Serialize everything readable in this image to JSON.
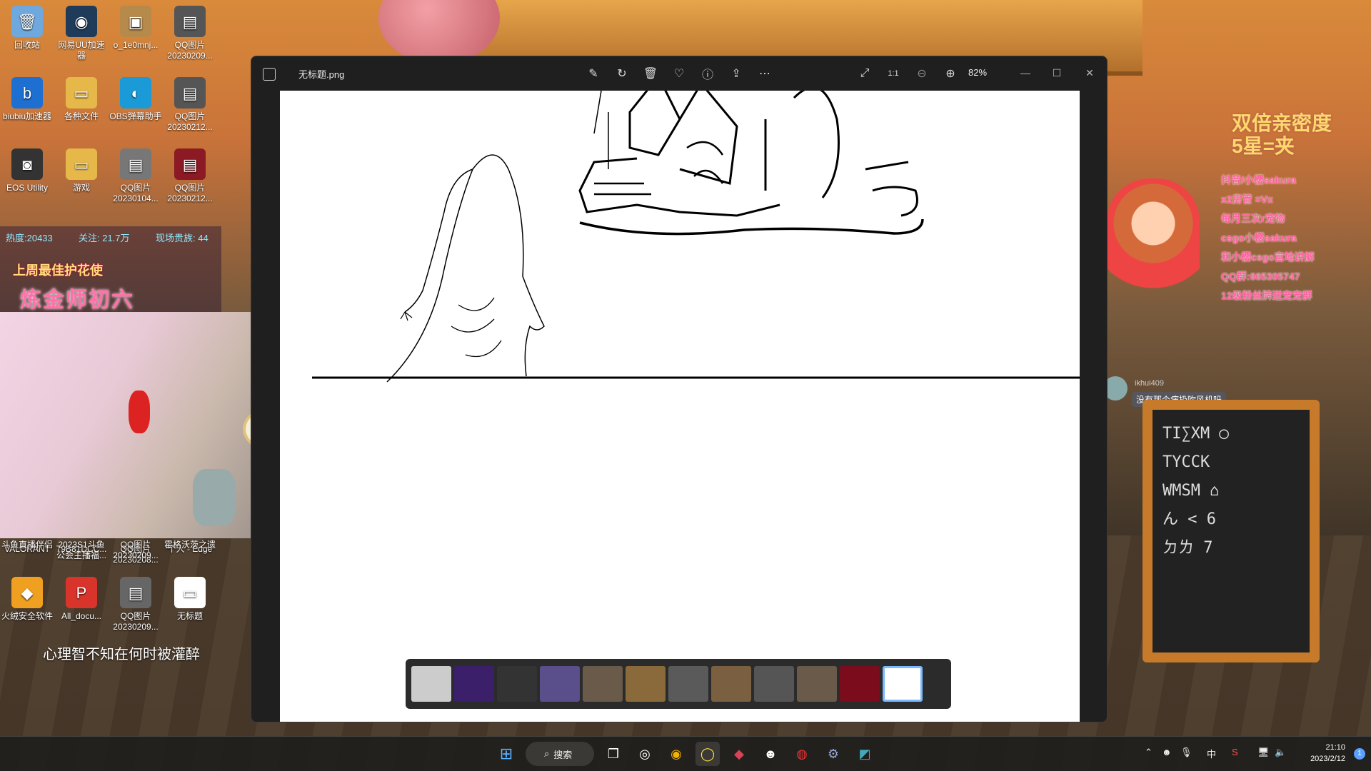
{
  "desktop": {
    "icons": [
      {
        "label": "回收站",
        "glyph": "🗑",
        "color": "#6fa8dc"
      },
      {
        "label": "网易UU加速器",
        "glyph": "◉",
        "color": "#1e3b5a"
      },
      {
        "label": "o_1e0mnj...",
        "glyph": "▣",
        "color": "#b58a4a"
      },
      {
        "label": "QQ图片 20230209...",
        "glyph": "▤",
        "color": "#555"
      },
      {
        "label": "biubiu加速器",
        "glyph": "b",
        "color": "#1d6fd1"
      },
      {
        "label": "各种文件",
        "glyph": "▭",
        "color": "#e6b84a"
      },
      {
        "label": "OBS弹幕助手",
        "glyph": "◐",
        "color": "#1a9ad6"
      },
      {
        "label": "QQ图片 20230212...",
        "glyph": "▤",
        "color": "#555"
      },
      {
        "label": "EOS Utility",
        "glyph": "◙",
        "color": "#333"
      },
      {
        "label": "游戏",
        "glyph": "▭",
        "color": "#e6b84a"
      },
      {
        "label": "QQ图片 20230104...",
        "glyph": "▤",
        "color": "#777"
      },
      {
        "label": "QQ图片 20230212...",
        "glyph": "▤",
        "color": "#8b1a24"
      },
      {
        "label": "VALORANT",
        "glyph": "",
        "color": "transparent"
      },
      {
        "label": "79B81DCC...",
        "glyph": "",
        "color": "transparent"
      },
      {
        "label": "QQ图片 20230208...",
        "glyph": "",
        "color": "transparent"
      },
      {
        "label": "个人 - Edge",
        "glyph": "",
        "color": "transparent"
      },
      {
        "label": "斗鱼直播伴侣",
        "glyph": "鱼",
        "color": "#f08a1e"
      },
      {
        "label": "2023S1斗鱼公会主播福...",
        "glyph": "S",
        "color": "#2aa84a"
      },
      {
        "label": "QQ图片 20230209...",
        "glyph": "▤",
        "color": "#444"
      },
      {
        "label": "霍格沃茨之遗",
        "glyph": "⚡",
        "color": "#223"
      },
      {
        "label": "火绒安全软件",
        "glyph": "◆",
        "color": "#f0a020"
      },
      {
        "label": "All_docu...",
        "glyph": "P",
        "color": "#d9342b"
      },
      {
        "label": "QQ图片 20230209...",
        "glyph": "▤",
        "color": "#666"
      },
      {
        "label": "无标题",
        "glyph": "▭",
        "color": "#fff"
      }
    ]
  },
  "stream_overlay": {
    "stats_left": "热度:20433",
    "stats_mid": "关注: 21.7万",
    "stats_right": "现场贵族: 44",
    "banner_line1": "上周最佳护花使",
    "banner_line2": "炼金师初六",
    "overlay_text": "心理智不知在何时被灌醉",
    "right_title_1": "双倍亲密度",
    "right_title_2": "5星=夹",
    "right_lines": [
      "抖音/小樱sakura",
      "x2房管  =Vx",
      "每月三次r宠物",
      "csgo小樱sakura",
      "和小樱csgo宫地讲解",
      "QQ群:665305747",
      "12级粉丝牌送宠宠群"
    ],
    "chat_user": "ikhui409",
    "chat_msg": "没有那个病扔吹风机吗"
  },
  "viewer": {
    "filename": "无标题.png",
    "zoom": "82%",
    "toolbar_icons": [
      "edit-icon",
      "rotate-icon",
      "delete-icon",
      "favorite-icon",
      "info-icon",
      "share-icon",
      "more-icon"
    ],
    "right_icons": [
      "fullscreen-icon",
      "actual-size-icon",
      "zoom-out-icon",
      "zoom-in-icon"
    ],
    "thumbnails": [
      {
        "color": "#ccc"
      },
      {
        "color": "#3b1f6a"
      },
      {
        "color": "#333"
      },
      {
        "color": "#5a4f8a"
      },
      {
        "color": "#6a5a4a"
      },
      {
        "color": "#8a6a3a"
      },
      {
        "color": "#5a5a5a"
      },
      {
        "color": "#7a6040"
      },
      {
        "color": "#555"
      },
      {
        "color": "#6a5a4a"
      },
      {
        "color": "#7a0c1c"
      },
      {
        "color": "#fff",
        "selected": true
      }
    ]
  },
  "taskbar": {
    "search_label": "搜索",
    "ime": "中",
    "time": "21:10",
    "date": "2023/2/12",
    "notifications": "1"
  }
}
